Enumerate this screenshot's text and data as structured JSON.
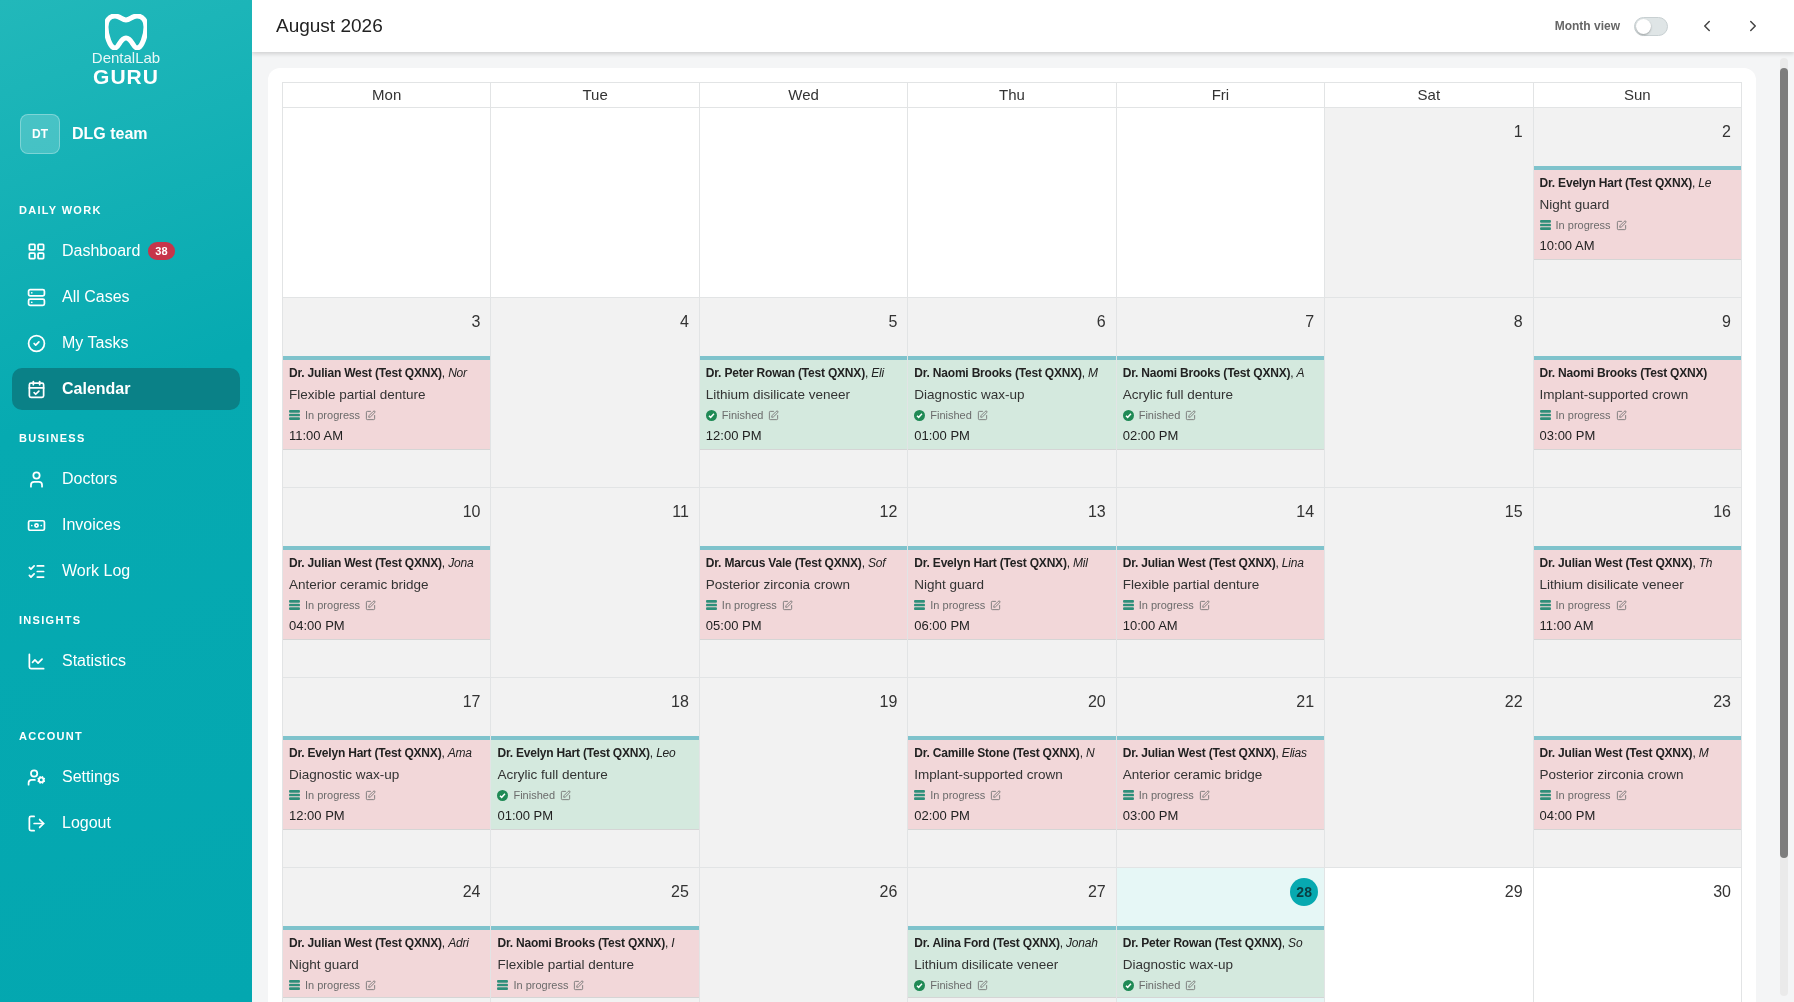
{
  "sidebar": {
    "logo": {
      "line1": "DentalLab",
      "line2": "GURU"
    },
    "user": {
      "initials": "DT",
      "name": "DLG team"
    },
    "sections": [
      {
        "title": "DAILY WORK",
        "items": [
          {
            "label": "Dashboard",
            "badge": "38",
            "selected": false
          },
          {
            "label": "All Cases",
            "selected": false
          },
          {
            "label": "My Tasks",
            "selected": false
          },
          {
            "label": "Calendar",
            "selected": true
          }
        ]
      },
      {
        "title": "BUSINESS",
        "items": [
          {
            "label": "Doctors",
            "selected": false
          },
          {
            "label": "Invoices",
            "selected": false
          },
          {
            "label": "Work Log",
            "selected": false
          }
        ]
      },
      {
        "title": "INSIGHTS",
        "items": [
          {
            "label": "Statistics",
            "selected": false
          }
        ]
      },
      {
        "title": "ACCOUNT",
        "items": [
          {
            "label": "Settings",
            "selected": false
          },
          {
            "label": "Logout",
            "selected": false
          }
        ]
      }
    ]
  },
  "header": {
    "title": "August 2026",
    "view_toggle": {
      "label": "Month view",
      "on": false
    }
  },
  "calendar": {
    "weekdays": [
      "Mon",
      "Tue",
      "Wed",
      "Thu",
      "Fri",
      "Sat",
      "Sun"
    ],
    "weeks": [
      {
        "days": [
          {
            "kind": "blank"
          },
          {
            "kind": "blank"
          },
          {
            "kind": "blank"
          },
          {
            "kind": "blank"
          },
          {
            "kind": "blank"
          },
          {
            "kind": "past",
            "number": "1"
          },
          {
            "kind": "past",
            "number": "2",
            "event": {
              "title": "**Dr. Evelyn Hart (Test QXNX)**, *Le*",
              "procedure": "Night guard",
              "status": {
                "kind": "in_progress",
                "label": "In progress"
              },
              "time": "10:00 AM"
            }
          }
        ]
      },
      {
        "days": [
          {
            "kind": "past",
            "number": "3",
            "event": {
              "title": "**Dr. Julian West (Test QXNX)**, *Nor*",
              "procedure": "Flexible partial denture",
              "status": {
                "kind": "in_progress",
                "label": "In progress"
              },
              "time": "11:00 AM"
            }
          },
          {
            "kind": "past",
            "number": "4"
          },
          {
            "kind": "past",
            "number": "5",
            "event": {
              "title": "**Dr. Peter Rowan (Test QXNX)**, *Eli*",
              "procedure": "Lithium disilicate veneer",
              "status": {
                "kind": "finished",
                "label": "Finished"
              },
              "time": "12:00 PM"
            }
          },
          {
            "kind": "past",
            "number": "6",
            "event": {
              "title": "**Dr. Naomi Brooks (Test QXNX)**, *M*",
              "procedure": "Diagnostic wax-up",
              "status": {
                "kind": "finished",
                "label": "Finished"
              },
              "time": "01:00 PM"
            }
          },
          {
            "kind": "past",
            "number": "7",
            "event": {
              "title": "**Dr. Naomi Brooks (Test QXNX)**, *A*",
              "procedure": "Acrylic full denture",
              "status": {
                "kind": "finished",
                "label": "Finished"
              },
              "time": "02:00 PM"
            }
          },
          {
            "kind": "past",
            "number": "8"
          },
          {
            "kind": "past",
            "number": "9",
            "event": {
              "title": "**Dr. Naomi Brooks (Test QXNX)**",
              "procedure": "Implant-supported crown",
              "status": {
                "kind": "in_progress",
                "label": "In progress"
              },
              "time": "03:00 PM"
            }
          }
        ]
      },
      {
        "days": [
          {
            "kind": "past",
            "number": "10",
            "event": {
              "title": "**Dr. Julian West (Test QXNX)**, *Jona*",
              "procedure": "Anterior ceramic bridge",
              "status": {
                "kind": "in_progress",
                "label": "In progress"
              },
              "time": "04:00 PM"
            }
          },
          {
            "kind": "past",
            "number": "11"
          },
          {
            "kind": "past",
            "number": "12",
            "event": {
              "title": "**Dr. Marcus Vale (Test QXNX)**, *Sof*",
              "procedure": "Posterior zirconia crown",
              "status": {
                "kind": "in_progress",
                "label": "In progress"
              },
              "time": "05:00 PM"
            }
          },
          {
            "kind": "past",
            "number": "13",
            "event": {
              "title": "**Dr. Evelyn Hart (Test QXNX)**, *Mil*",
              "procedure": "Night guard",
              "status": {
                "kind": "in_progress",
                "label": "In progress"
              },
              "time": "06:00 PM"
            }
          },
          {
            "kind": "past",
            "number": "14",
            "event": {
              "title": "**Dr. Julian West (Test QXNX)**, *Lina*",
              "procedure": "Flexible partial denture",
              "status": {
                "kind": "in_progress",
                "label": "In progress"
              },
              "time": "10:00 AM"
            }
          },
          {
            "kind": "past",
            "number": "15"
          },
          {
            "kind": "past",
            "number": "16",
            "event": {
              "title": "**Dr. Julian West (Test QXNX)**, *Th*",
              "procedure": "Lithium disilicate veneer",
              "status": {
                "kind": "in_progress",
                "label": "In progress"
              },
              "time": "11:00 AM"
            }
          }
        ]
      },
      {
        "days": [
          {
            "kind": "past",
            "number": "17",
            "event": {
              "title": "**Dr. Evelyn Hart (Test QXNX)**, *Ama*",
              "procedure": "Diagnostic wax-up",
              "status": {
                "kind": "in_progress",
                "label": "In progress"
              },
              "time": "12:00 PM"
            }
          },
          {
            "kind": "past",
            "number": "18",
            "event": {
              "title": "**Dr. Evelyn Hart (Test QXNX)**, *Leo*",
              "procedure": "Acrylic full denture",
              "status": {
                "kind": "finished",
                "label": "Finished"
              },
              "time": "01:00 PM"
            }
          },
          {
            "kind": "past",
            "number": "19"
          },
          {
            "kind": "past",
            "number": "20",
            "event": {
              "title": "**Dr. Camille Stone (Test QXNX)**, *N*",
              "procedure": "Implant-supported crown",
              "status": {
                "kind": "in_progress",
                "label": "In progress"
              },
              "time": "02:00 PM"
            }
          },
          {
            "kind": "past",
            "number": "21",
            "event": {
              "title": "**Dr. Julian West (Test QXNX)**, *Elias*",
              "procedure": "Anterior ceramic bridge",
              "status": {
                "kind": "in_progress",
                "label": "In progress"
              },
              "time": "03:00 PM"
            }
          },
          {
            "kind": "past",
            "number": "22"
          },
          {
            "kind": "past",
            "number": "23",
            "event": {
              "title": "**Dr. Julian West (Test QXNX)**, *M*",
              "procedure": "Posterior zirconia crown",
              "status": {
                "kind": "in_progress",
                "label": "In progress"
              },
              "time": "04:00 PM"
            }
          }
        ]
      },
      {
        "days": [
          {
            "kind": "past",
            "number": "24",
            "event": {
              "title": "**Dr. Julian West (Test QXNX)**, *Adri*",
              "procedure": "Night guard",
              "status": {
                "kind": "in_progress",
                "label": "In progress"
              }
            }
          },
          {
            "kind": "past",
            "number": "25",
            "event": {
              "title": "**Dr. Naomi Brooks (Test QXNX)**, *I*",
              "procedure": "Flexible partial denture",
              "status": {
                "kind": "in_progress",
                "label": "In progress"
              }
            }
          },
          {
            "kind": "past",
            "number": "26"
          },
          {
            "kind": "past",
            "number": "27",
            "event": {
              "title": "**Dr. Alina Ford (Test QXNX)**, *Jonah*",
              "procedure": "Lithium disilicate veneer",
              "status": {
                "kind": "finished",
                "label": "Finished"
              }
            }
          },
          {
            "kind": "today",
            "number": "28",
            "event": {
              "title": "**Dr. Peter Rowan (Test QXNX)**, *So*",
              "procedure": "Diagnostic wax-up",
              "status": {
                "kind": "finished",
                "label": "Finished"
              }
            }
          },
          {
            "kind": "future",
            "number": "29"
          },
          {
            "kind": "future",
            "number": "30"
          }
        ]
      }
    ]
  }
}
